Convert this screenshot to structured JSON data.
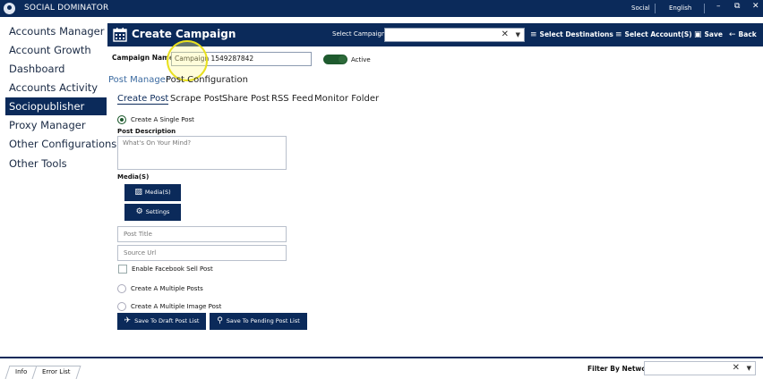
{
  "app": {
    "title": "SOCIAL DOMINATOR",
    "network": "Social",
    "language": "English"
  },
  "sidebar": {
    "items": [
      {
        "label": "Accounts Manager"
      },
      {
        "label": "Account Growth"
      },
      {
        "label": "Dashboard"
      },
      {
        "label": "Accounts Activity"
      },
      {
        "label": "Sociopublisher",
        "active": true
      },
      {
        "label": "Proxy Manager"
      },
      {
        "label": "Other Configurations"
      },
      {
        "label": "Other Tools"
      }
    ]
  },
  "header": {
    "title": "Create Campaign",
    "select_campaign_label": "Select Campaign",
    "select_campaign_value": "",
    "select_destinations": "Select Destinations",
    "select_accounts": "Select Account(S)",
    "save": "Save",
    "back": "Back"
  },
  "campaign": {
    "name_label": "Campaign Name",
    "name_value": "Campaign 1549287842",
    "active_label": "Active",
    "active": true
  },
  "section": {
    "manager": "Post Manager",
    "config": "Post Configuration"
  },
  "tabs": [
    "Create Post",
    "Scrape Post",
    "Share Post",
    "RSS Feed",
    "Monitor Folder"
  ],
  "form": {
    "single_post": "Create A Single Post",
    "post_description_label": "Post Description",
    "post_description_placeholder": "What's On Your Mind?",
    "media_label": "Media(S)",
    "media_button": "Media(S)",
    "settings_button": "Settings",
    "post_title_placeholder": "Post Title",
    "source_url_placeholder": "Source Url",
    "facebook_sell": "Enable Facebook Sell Post",
    "multiple_posts": "Create A Multiple Posts",
    "multiple_image": "Create A Multiple Image Post",
    "save_draft": "Save To Draft Post List",
    "save_pending": "Save To Pending Post List"
  },
  "bottom": {
    "tab_info": "Info",
    "tab_errors": "Error List",
    "filter_label": "Filter By Network",
    "filter_value": ""
  },
  "colors": {
    "navy": "#0b2a5a",
    "green": "#1e5a2e",
    "link_blue": "#3b6aa0"
  }
}
